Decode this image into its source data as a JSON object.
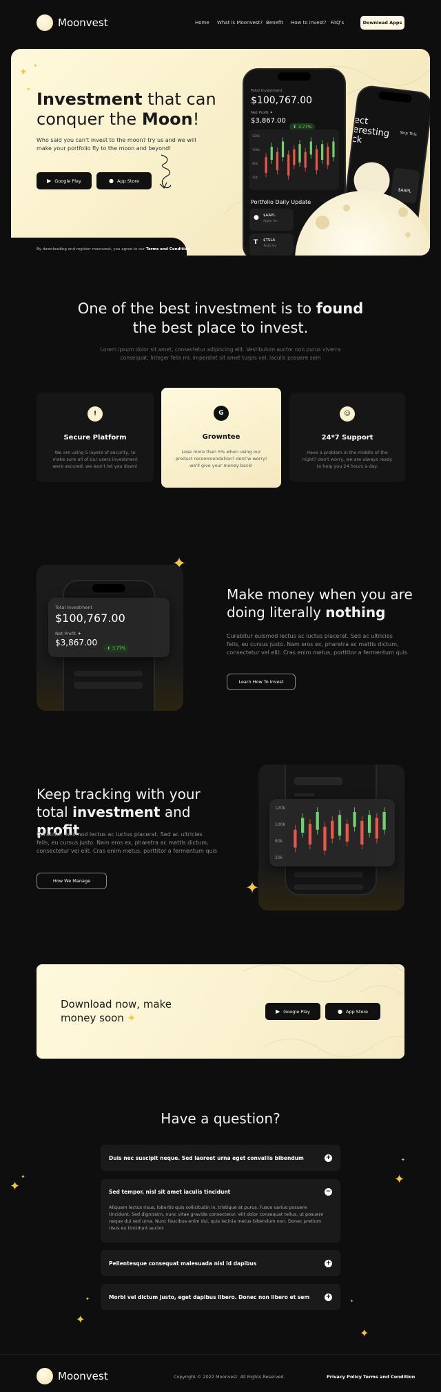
{
  "brand": {
    "name": "Moonvest"
  },
  "nav": {
    "links": [
      "Home",
      "What is Moonvest?",
      "Benefit",
      "How to invest?",
      "FAQ's"
    ],
    "download_label": "Download Apps"
  },
  "hero": {
    "title_bold_1": "Investment",
    "title_rest_1": " that can",
    "title_pre_2": "conquer the ",
    "title_bold_2": "Moon",
    "title_end": "!",
    "subtitle": "Who said you can't invest to the moon? try us and we will make your portfolio fly to the moon and beyond!",
    "google_play_label": "Google Play",
    "app_store_label": "App Store",
    "terms_prefix": "By downloading and register moonvest, you agree to our ",
    "terms_link": "Terms and Condition",
    "phone": {
      "total_label": "Total Investment",
      "total_value": "$100,767.00",
      "profit_label": "Net Profit",
      "profit_value": "$3,867.00",
      "profit_pct": "3.77%",
      "y_ticks": [
        "120k",
        "100k",
        "80k",
        "20k"
      ],
      "portfolio_label": "Portfolio Daily Update",
      "tickers": [
        "$AAPL",
        "$TSLA"
      ],
      "ticker_sub": [
        "Apple Inc",
        "Tesla Inc"
      ]
    },
    "phone2": {
      "text_1": "ect",
      "text_2": "eresting",
      "text_3": "ck",
      "skip_label": "Skip This",
      "ticker": "$AAPL"
    }
  },
  "intro": {
    "title_pre": "One of the best investment is to ",
    "title_bold": "found",
    "title_line2": "the best place to invest.",
    "body": "Lorem ipsum dolor sit amet, consectetur adipiscing elit. Vestibulum auctor non purus viverra consequat. Integer felis mi, imperdiet sit amet turpis vel, iaculis posuere sem"
  },
  "features": [
    {
      "icon": "shield-icon",
      "glyph": "!",
      "title": "Secure Platform",
      "desc": "We are using 5 layers of security, to make sure all of our users investment were secured. we won't let you down!"
    },
    {
      "icon": "growntee-icon",
      "glyph": "G",
      "title": "Growntee",
      "desc": "Lose more than 5% when using our product recommendation? dont'w worry! we'll give your money back!"
    },
    {
      "icon": "support-icon",
      "glyph": "☺",
      "title": "24*7 Support",
      "desc": "Have a problem in the middle of the night? don't worry, we are always ready to help you 24 hours a day."
    }
  ],
  "money": {
    "title_line1": "Make money when you are",
    "title_pre2": "doing literally ",
    "title_bold": "nothing",
    "body": "Curabitur euismod lectus ac luctus placerat. Sed ac ultricies felis, eu cursus justo. Nam eros ex, pharetra ac mattis dictum, consectetur vel elit. Cras enim metus, porttitor a fermentum quis",
    "button": "Learn How To Invest",
    "total_label": "Total Investment",
    "total_value": "$100,767.00",
    "profit_label": "Net Profit",
    "profit_value": "$3,867.00",
    "profit_pct": "3.77%"
  },
  "tracking": {
    "title_line1": "Keep tracking with your",
    "title_pre2": "total ",
    "title_bold1": "investment",
    "title_mid": " and ",
    "title_bold2": "profit",
    "body": "Curabitur euismod lectus ac luctus placerat. Sed ac ultricies felis, eu cursus justo. Nam eros ex, pharetra ac mattis dictum, consectetur vel elit. Cras enim metus, porttitor a fermentum quis",
    "button": "How We Manage",
    "y_ticks": [
      "120k",
      "100k",
      "80k",
      "20k"
    ]
  },
  "cta": {
    "line1": "Download now, make",
    "line2": "money soon",
    "google_play_label": "Google Play",
    "app_store_label": "App Store"
  },
  "faq": {
    "title": "Have a question?",
    "items": [
      {
        "q": "Duis nec suscipit neque. Sed laoreet urna eget convallis bibendum",
        "toggle": "+"
      },
      {
        "q": "Sed tempor, nisl sit amet iaculis tincidunt",
        "toggle": "−",
        "a": "Aliquam lectus risus, lobortis quis sollicitudin in, tristique at purus. Fusce varius posuere tincidunt. Sed dignissim, nunc vitae gravida consectetur, elit dolor consequat tellus, ut posuere neque dui sed urna. Nunc faucibus enim dui, quis lacinia metus bibendum non. Donec pretium risus eu tincidunt auctor."
      },
      {
        "q": "Pellentesque consequat malesuada nisl id dapibus",
        "toggle": "+"
      },
      {
        "q": "Morbi vel dictum justo, eget dapibus libero. Donec non libero et sem",
        "toggle": "+"
      }
    ]
  },
  "footer": {
    "copyright": "Copyright © 2022 Moonvest. All Rights Reserved.",
    "links": [
      "Privacy Policy",
      "Terms and Condition"
    ]
  },
  "colors": {
    "accent": "#f4c542",
    "cream": "#fff8e2",
    "up": "#6fd06f",
    "down": "#e8574a"
  }
}
